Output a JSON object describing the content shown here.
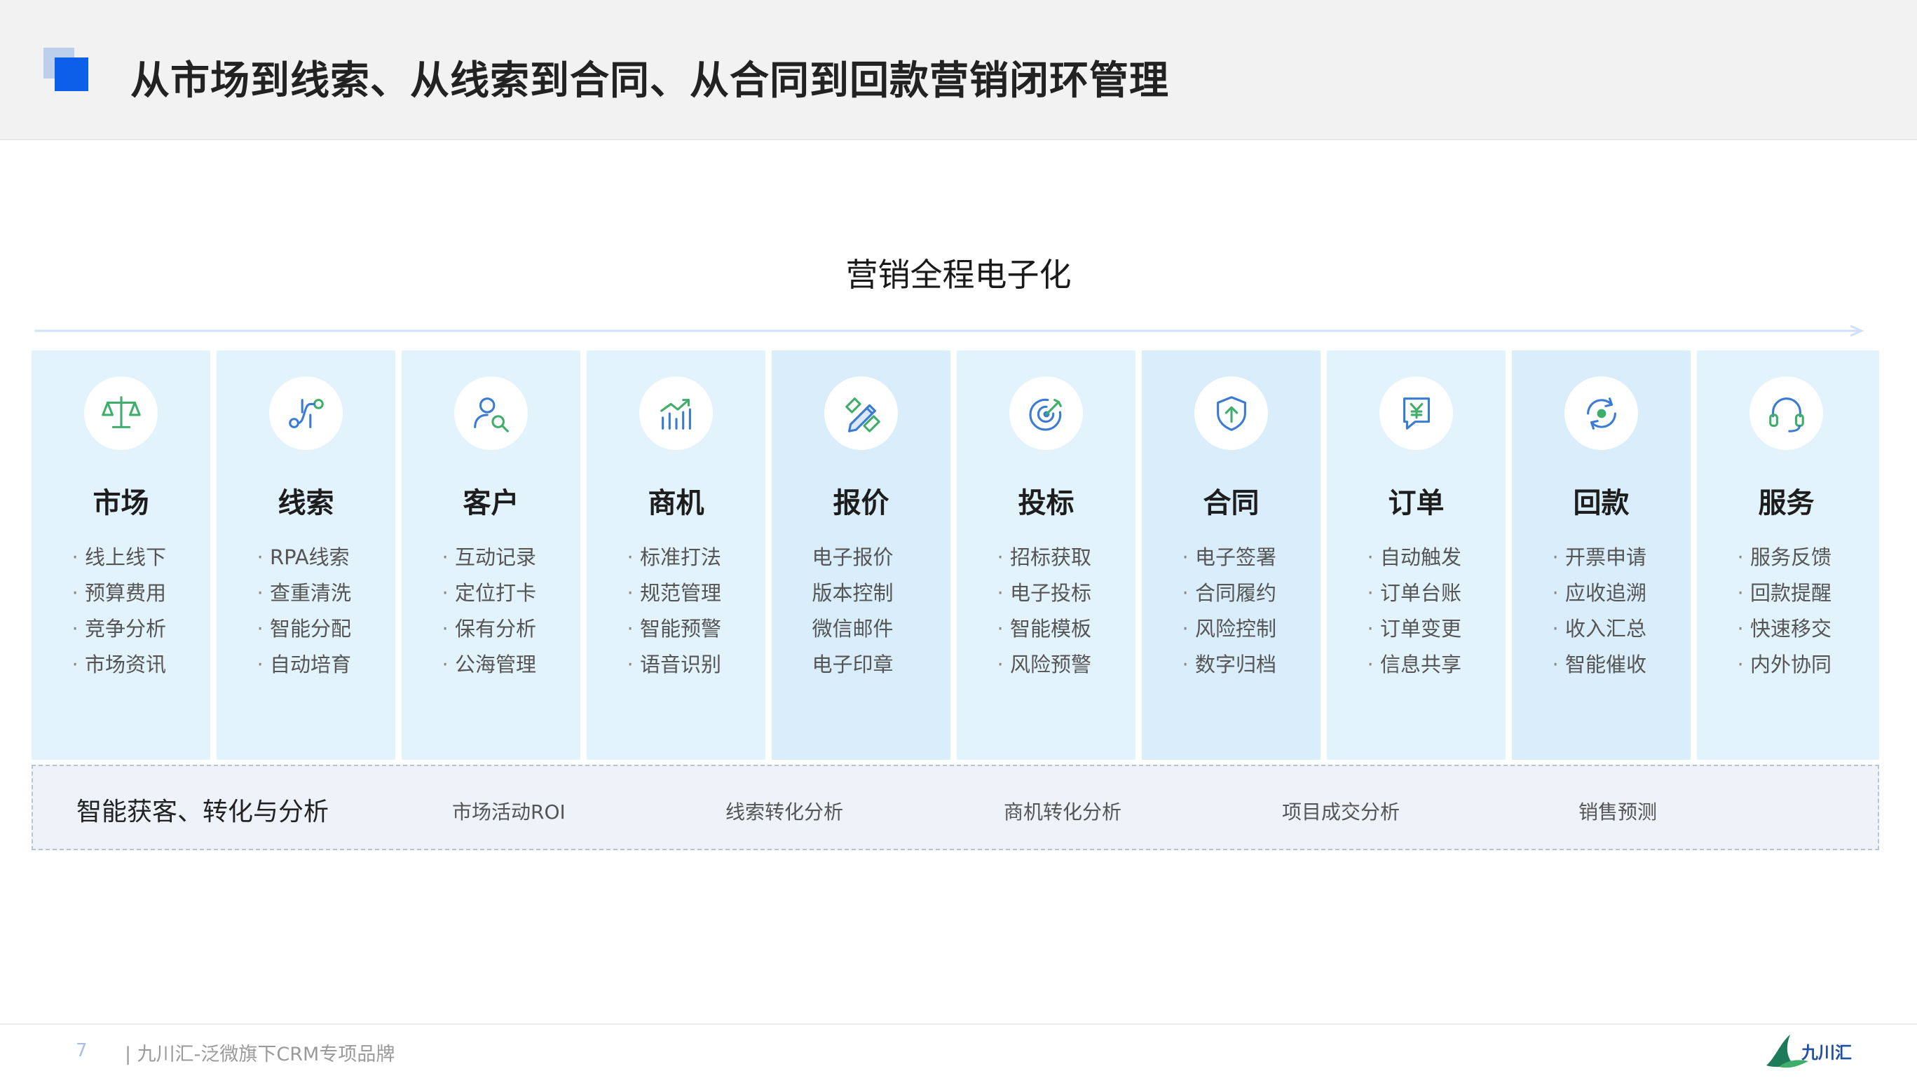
{
  "header": {
    "title": "从市场到线索、从线索到合同、从合同到回款营销闭环管理"
  },
  "subtitle": "营销全程电子化",
  "colors": {
    "accent": "#0d5ee8",
    "icon_blue": "#3a7bd5",
    "icon_green": "#3fae6a"
  },
  "stages": [
    {
      "title": "市场",
      "icon": "balance-scale-icon",
      "dotted": true,
      "items": [
        "线上线下",
        "预算费用",
        "竞争分析",
        "市场资讯"
      ]
    },
    {
      "title": "线索",
      "icon": "route-icon",
      "dotted": true,
      "items": [
        "RPA线索",
        "查重清洗",
        "智能分配",
        "自动培育"
      ]
    },
    {
      "title": "客户",
      "icon": "user-search-icon",
      "dotted": true,
      "items": [
        "互动记录",
        "定位打卡",
        "保有分析",
        "公海管理"
      ]
    },
    {
      "title": "商机",
      "icon": "trend-chart-icon",
      "dotted": true,
      "items": [
        "标准打法",
        "规范管理",
        "智能预警",
        "语音识别"
      ]
    },
    {
      "title": "报价",
      "icon": "pencil-ruler-icon",
      "dotted": false,
      "items": [
        "电子报价",
        "版本控制",
        "微信邮件",
        "电子印章"
      ]
    },
    {
      "title": "投标",
      "icon": "target-icon",
      "dotted": true,
      "items": [
        "招标获取",
        "电子投标",
        "智能模板",
        "风险预警"
      ]
    },
    {
      "title": "合同",
      "icon": "shield-arrow-icon",
      "dotted": true,
      "items": [
        "电子签署",
        "合同履约",
        "风险控制",
        "数字归档"
      ]
    },
    {
      "title": "订单",
      "icon": "yuan-document-icon",
      "dotted": true,
      "items": [
        "自动触发",
        "订单台账",
        "订单变更",
        "信息共享"
      ]
    },
    {
      "title": "回款",
      "icon": "refresh-cycle-icon",
      "dotted": true,
      "items": [
        "开票申请",
        "应收追溯",
        "收入汇总",
        "智能催收"
      ]
    },
    {
      "title": "服务",
      "icon": "headset-icon",
      "dotted": true,
      "items": [
        "服务反馈",
        "回款提醒",
        "快速移交",
        "内外协同"
      ]
    }
  ],
  "analysis": {
    "label": "智能获客、转化与分析",
    "items": [
      "市场活动ROI",
      "线索转化分析",
      "商机转化分析",
      "项目成交分析",
      "销售预测"
    ]
  },
  "footer": {
    "page_number": "7",
    "text": "| 九川汇-泛微旗下CRM专项品牌"
  },
  "logo": {
    "text": "九川汇"
  }
}
